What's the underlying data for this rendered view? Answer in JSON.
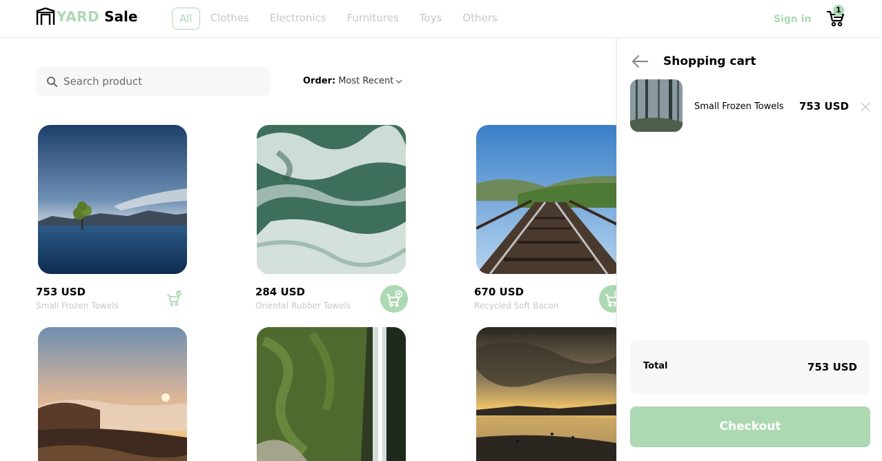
{
  "brand": {
    "yard": "YARD",
    "sale": "Sale"
  },
  "nav": {
    "items": [
      {
        "label": "All",
        "active": true
      },
      {
        "label": "Clothes"
      },
      {
        "label": "Electronics"
      },
      {
        "label": "Furnitures"
      },
      {
        "label": "Toys"
      },
      {
        "label": "Others"
      }
    ],
    "signin": "Sign in",
    "cart_count": "1"
  },
  "search": {
    "placeholder": "Search product"
  },
  "order": {
    "label": "Order:",
    "value": "Most Recent"
  },
  "products": [
    {
      "price": "753 USD",
      "name": "Small Frozen Towels",
      "in_cart": true,
      "image": "lake-tree"
    },
    {
      "price": "284 USD",
      "name": "Oriental Rubber Towels",
      "in_cart": false,
      "image": "ocean-waves"
    },
    {
      "price": "670 USD",
      "name": "Recycled Soft Bacon",
      "in_cart": false,
      "image": "railway-bridge"
    },
    {
      "price": "",
      "name": "",
      "in_cart": false,
      "image": "sunset-mountain"
    },
    {
      "price": "",
      "name": "",
      "in_cart": false,
      "image": "waterfall"
    },
    {
      "price": "",
      "name": "",
      "in_cart": false,
      "image": "beach-sunset"
    }
  ],
  "cart": {
    "title": "Shopping cart",
    "items": [
      {
        "name": "Small Frozen Towels",
        "price": "753 USD",
        "image": "foggy-forest"
      }
    ],
    "total_label": "Total",
    "total_value": "753 USD",
    "checkout_label": "Checkout"
  },
  "colors": {
    "accent": "#acd9b2",
    "muted_text": "#c7c7c7",
    "panel_bg": "#f7f7f7"
  }
}
